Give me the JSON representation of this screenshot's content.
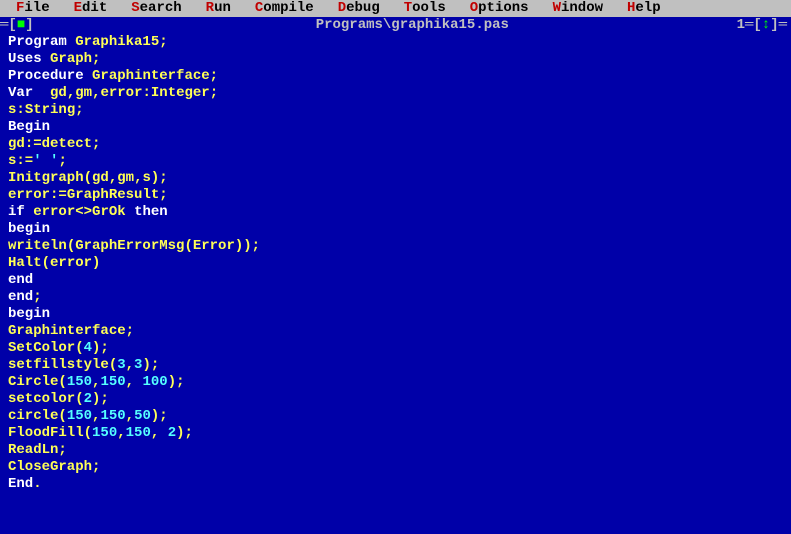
{
  "menu": {
    "items": [
      {
        "hot": "F",
        "rest": "ile"
      },
      {
        "hot": "E",
        "rest": "dit"
      },
      {
        "hot": "S",
        "rest": "earch"
      },
      {
        "hot": "R",
        "rest": "un"
      },
      {
        "hot": "C",
        "rest": "ompile"
      },
      {
        "hot": "D",
        "rest": "ebug"
      },
      {
        "hot": "T",
        "rest": "ools"
      },
      {
        "hot": "O",
        "rest": "ptions"
      },
      {
        "hot": "W",
        "rest": "indow"
      },
      {
        "hot": "H",
        "rest": "elp"
      }
    ]
  },
  "titlebar": {
    "close_glyph": "■",
    "title": " Programs\\graphika15.pas ",
    "window_num": "1",
    "updown_glyph": "↕"
  },
  "code": [
    [
      [
        "kw",
        "Program"
      ],
      [
        "punc",
        " "
      ],
      [
        "id",
        "Graphika15"
      ],
      [
        "punc",
        ";"
      ]
    ],
    [
      [
        "kw",
        "Uses"
      ],
      [
        "punc",
        " "
      ],
      [
        "id",
        "Graph"
      ],
      [
        "punc",
        ";"
      ]
    ],
    [
      [
        "kw",
        "Procedure"
      ],
      [
        "punc",
        " "
      ],
      [
        "id",
        "Graphinterface"
      ],
      [
        "punc",
        ";"
      ]
    ],
    [
      [
        "kw",
        "Var"
      ],
      [
        "punc",
        "  "
      ],
      [
        "id",
        "gd"
      ],
      [
        "punc",
        ","
      ],
      [
        "id",
        "gm"
      ],
      [
        "punc",
        ","
      ],
      [
        "id",
        "error"
      ],
      [
        "punc",
        ":"
      ],
      [
        "id",
        "Integer"
      ],
      [
        "punc",
        ";"
      ]
    ],
    [
      [
        "id",
        "s"
      ],
      [
        "punc",
        ":"
      ],
      [
        "id",
        "String"
      ],
      [
        "punc",
        ";"
      ]
    ],
    [
      [
        "kw",
        "Begin"
      ]
    ],
    [
      [
        "id",
        "gd"
      ],
      [
        "punc",
        ":="
      ],
      [
        "id",
        "detect"
      ],
      [
        "punc",
        ";"
      ]
    ],
    [
      [
        "id",
        "s"
      ],
      [
        "punc",
        ":="
      ],
      [
        "str",
        "' '"
      ],
      [
        "punc",
        ";"
      ]
    ],
    [
      [
        "id",
        "Initgraph"
      ],
      [
        "punc",
        "("
      ],
      [
        "id",
        "gd"
      ],
      [
        "punc",
        ","
      ],
      [
        "id",
        "gm"
      ],
      [
        "punc",
        ","
      ],
      [
        "id",
        "s"
      ],
      [
        "punc",
        ");"
      ]
    ],
    [
      [
        "id",
        "error"
      ],
      [
        "punc",
        ":="
      ],
      [
        "id",
        "GraphResult"
      ],
      [
        "punc",
        ";"
      ]
    ],
    [
      [
        "kw",
        "if"
      ],
      [
        "punc",
        " "
      ],
      [
        "id",
        "error"
      ],
      [
        "punc",
        "<>"
      ],
      [
        "id",
        "GrOk"
      ],
      [
        "punc",
        " "
      ],
      [
        "kw",
        "then"
      ]
    ],
    [
      [
        "kw",
        "begin"
      ]
    ],
    [
      [
        "id",
        "writeln"
      ],
      [
        "punc",
        "("
      ],
      [
        "id",
        "GraphErrorMsg"
      ],
      [
        "punc",
        "("
      ],
      [
        "id",
        "Error"
      ],
      [
        "punc",
        "));"
      ]
    ],
    [
      [
        "id",
        "Halt"
      ],
      [
        "punc",
        "("
      ],
      [
        "id",
        "error"
      ],
      [
        "punc",
        ")"
      ]
    ],
    [
      [
        "kw",
        "end"
      ]
    ],
    [
      [
        "kw",
        "end"
      ],
      [
        "punc",
        ";"
      ]
    ],
    [
      [
        "kw",
        "begin"
      ]
    ],
    [
      [
        "id",
        "Graphinterface"
      ],
      [
        "punc",
        ";"
      ]
    ],
    [
      [
        "id",
        "SetColor"
      ],
      [
        "punc",
        "("
      ],
      [
        "num",
        "4"
      ],
      [
        "punc",
        ");"
      ]
    ],
    [
      [
        "id",
        "setfillstyle"
      ],
      [
        "punc",
        "("
      ],
      [
        "num",
        "3"
      ],
      [
        "punc",
        ","
      ],
      [
        "num",
        "3"
      ],
      [
        "punc",
        ");"
      ]
    ],
    [
      [
        "id",
        "Circle"
      ],
      [
        "punc",
        "("
      ],
      [
        "num",
        "150"
      ],
      [
        "punc",
        ","
      ],
      [
        "num",
        "150"
      ],
      [
        "punc",
        ", "
      ],
      [
        "num",
        "100"
      ],
      [
        "punc",
        ");"
      ]
    ],
    [
      [
        "id",
        "setcolor"
      ],
      [
        "punc",
        "("
      ],
      [
        "num",
        "2"
      ],
      [
        "punc",
        ");"
      ]
    ],
    [
      [
        "id",
        "circle"
      ],
      [
        "punc",
        "("
      ],
      [
        "num",
        "150"
      ],
      [
        "punc",
        ","
      ],
      [
        "num",
        "150"
      ],
      [
        "punc",
        ","
      ],
      [
        "num",
        "50"
      ],
      [
        "punc",
        ");"
      ]
    ],
    [
      [
        "id",
        "FloodFill"
      ],
      [
        "punc",
        "("
      ],
      [
        "num",
        "150"
      ],
      [
        "punc",
        ","
      ],
      [
        "num",
        "150"
      ],
      [
        "punc",
        ", "
      ],
      [
        "num",
        "2"
      ],
      [
        "punc",
        ");"
      ]
    ],
    [
      [
        "id",
        "ReadLn"
      ],
      [
        "punc",
        ";"
      ]
    ],
    [
      [
        "id",
        "CloseGraph"
      ],
      [
        "punc",
        ";"
      ]
    ],
    [
      [
        "kw",
        "End"
      ],
      [
        "punc",
        "."
      ]
    ]
  ]
}
